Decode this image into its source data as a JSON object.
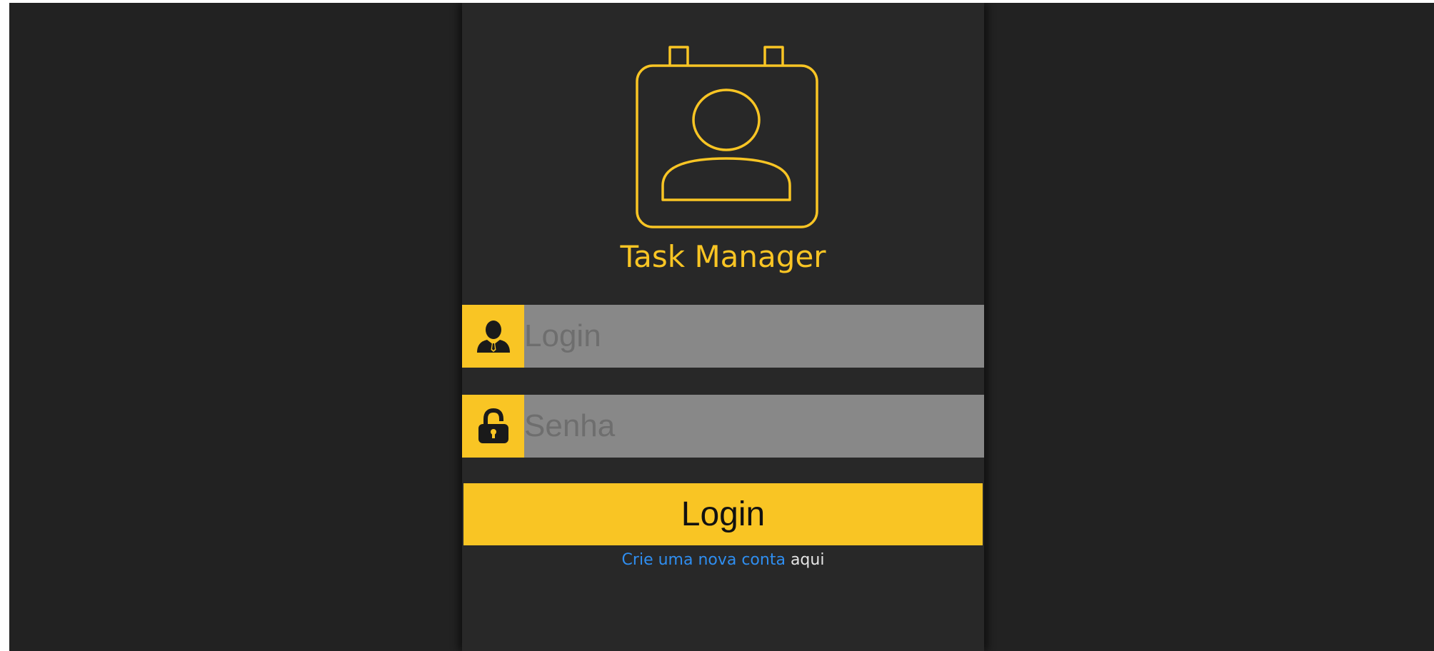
{
  "app": {
    "title": "Task Manager",
    "accent_color": "#f9c524",
    "logo_icon": "calendar-contact-icon"
  },
  "form": {
    "login": {
      "placeholder": "Login",
      "value": "",
      "icon": "user-icon"
    },
    "password": {
      "placeholder": "Senha",
      "value": "",
      "icon": "lock-icon"
    },
    "submit_label": "Login"
  },
  "signup": {
    "link_text": "Crie uma nova conta",
    "suffix_text": " aqui",
    "link_color": "#2f8ef0"
  }
}
